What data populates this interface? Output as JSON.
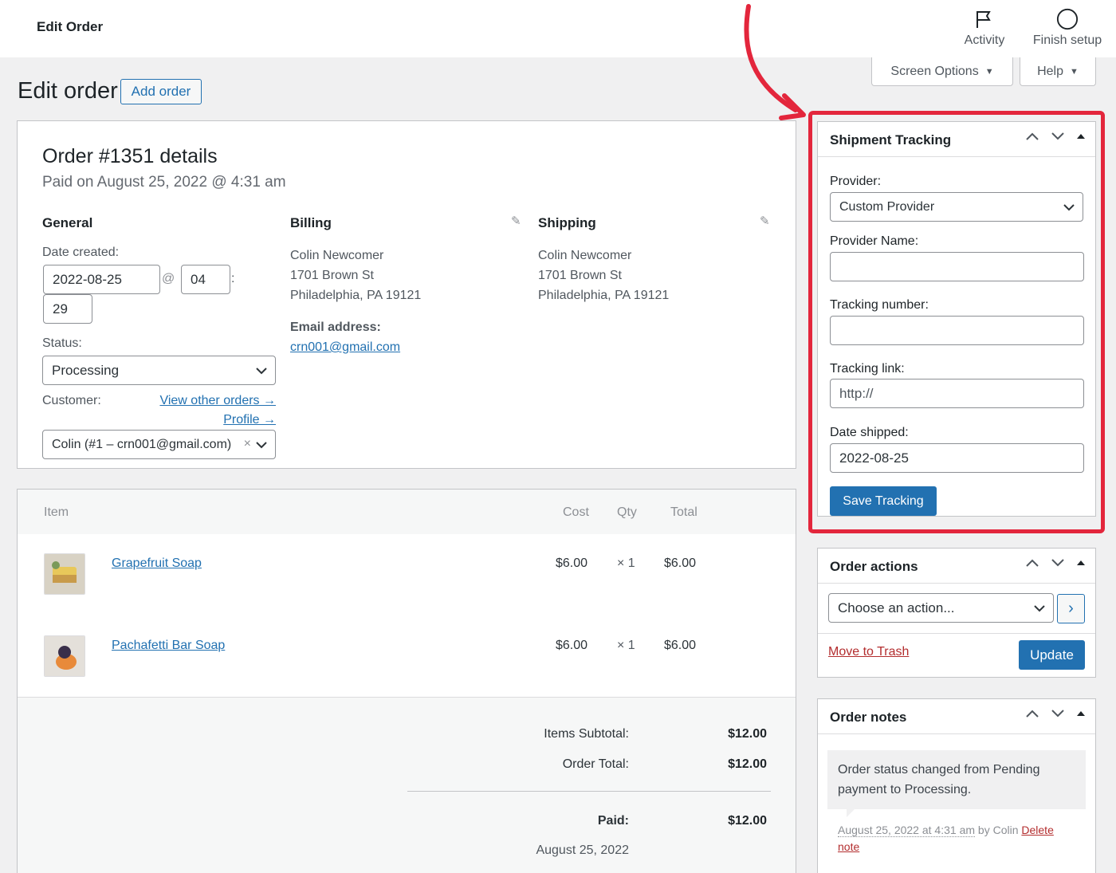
{
  "topbar": {
    "title": "Edit Order",
    "activity_label": "Activity",
    "finish_setup_label": "Finish setup"
  },
  "tabs": {
    "screen_options": "Screen Options",
    "help": "Help"
  },
  "heading": {
    "title": "Edit order",
    "add_order": "Add order"
  },
  "order": {
    "title": "Order #1351 details",
    "paid_on": "Paid on August 25, 2022 @ 4:31 am",
    "general": {
      "heading": "General",
      "date_created_label": "Date created:",
      "date": "2022-08-25",
      "at": "@",
      "hour": "04",
      "colon": ":",
      "minute": "29",
      "status_label": "Status:",
      "status": "Processing",
      "customer_label": "Customer:",
      "view_other_orders": "View other orders →",
      "profile": "Profile →",
      "customer": "Colin (#1 – crn001@gmail.com)",
      "clear": "×"
    },
    "billing": {
      "heading": "Billing",
      "name": "Colin Newcomer",
      "street": "1701 Brown St",
      "city": "Philadelphia, PA 19121",
      "email_label": "Email address:",
      "email": "crn001@gmail.com"
    },
    "shipping": {
      "heading": "Shipping",
      "name": "Colin Newcomer",
      "street": "1701 Brown St",
      "city": "Philadelphia, PA 19121"
    }
  },
  "items": {
    "headers": {
      "item": "Item",
      "cost": "Cost",
      "qty": "Qty",
      "total": "Total"
    },
    "rows": [
      {
        "name": "Grapefruit Soap",
        "cost": "$6.00",
        "qty": "× 1",
        "total": "$6.00"
      },
      {
        "name": "Pachafetti Bar Soap",
        "cost": "$6.00",
        "qty": "× 1",
        "total": "$6.00"
      }
    ],
    "totals": {
      "subtotal_label": "Items Subtotal:",
      "subtotal": "$12.00",
      "order_total_label": "Order Total:",
      "order_total": "$12.00",
      "paid_label": "Paid:",
      "paid": "$12.00",
      "paid_date": "August 25, 2022"
    }
  },
  "tracking": {
    "title": "Shipment Tracking",
    "provider_label": "Provider:",
    "provider": "Custom Provider",
    "provider_name_label": "Provider Name:",
    "provider_name": "",
    "tracking_number_label": "Tracking number:",
    "tracking_number": "",
    "tracking_link_label": "Tracking link:",
    "tracking_link_placeholder": "http://",
    "date_shipped_label": "Date shipped:",
    "date_shipped": "2022-08-25",
    "save": "Save Tracking"
  },
  "order_actions": {
    "title": "Order actions",
    "choose": "Choose an action...",
    "go": "›",
    "trash": "Move to Trash",
    "update": "Update"
  },
  "notes": {
    "title": "Order notes",
    "note_text": "Order status changed from Pending payment to Processing.",
    "note_date": "August 25, 2022 at 4:31 am",
    "note_by": "by Colin",
    "delete": "Delete note"
  },
  "colors": {
    "accent": "#2271b1",
    "highlight": "#e3263c",
    "danger": "#b32d2e"
  }
}
